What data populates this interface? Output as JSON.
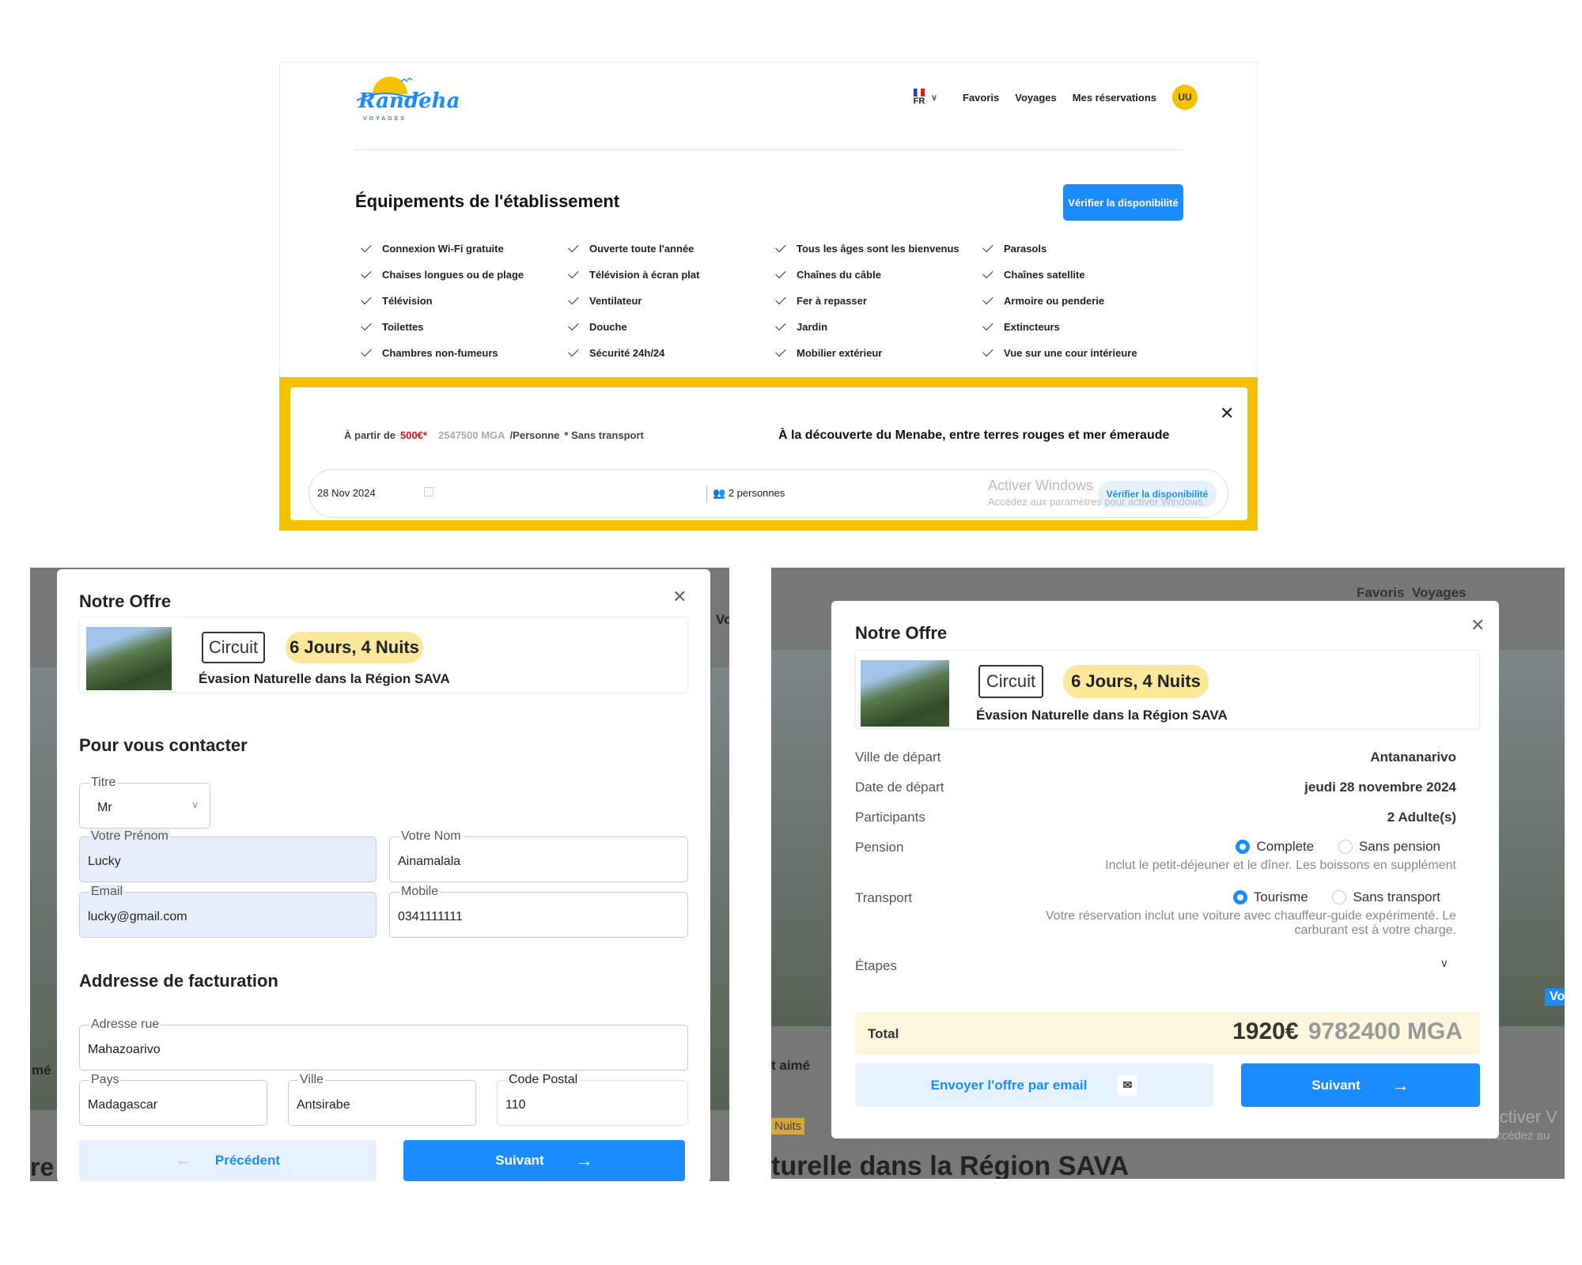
{
  "top": {
    "logo_text": "Randeha",
    "logo_sub": "VOYAGES",
    "lang": "FR",
    "nav": [
      "Favoris",
      "Voyages",
      "Mes réservations"
    ],
    "avatar": "UU",
    "section_title": "Équipements de l'établissement",
    "verify_label": "Vérifier la disponibilité",
    "amenities": [
      "Connexion Wi-Fi gratuite",
      "Ouverte toute l'année",
      "Tous les âges sont les bienvenus",
      "Parasols",
      "Chaises longues ou de plage",
      "Télévision à écran plat",
      "Chaînes du câble",
      "Chaînes satellite",
      "Télévision",
      "Ventilateur",
      "Fer à repasser",
      "Armoire ou penderie",
      "Toilettes",
      "Douche",
      "Jardin",
      "Extincteurs",
      "Chambres non-fumeurs",
      "Sécurité 24h/24",
      "Mobilier extérieur",
      "Vue sur une cour intérieure"
    ],
    "booking": {
      "from_label": "À partir de",
      "price_eur": "500€*",
      "price_mga": "2547500 MGA",
      "per_person": "/Personne",
      "transport": "* Sans transport",
      "tour_title": "À la découverte du Menabe, entre terres rouges et mer émeraude",
      "date": "28 Nov 2024",
      "persons": "2 personnes",
      "verify_label": "Vérifier la disponibilité",
      "watermark_title": "Activer Windows",
      "watermark_sub": "Accédez aux paramètres pour activer Windows."
    }
  },
  "left_modal": {
    "title": "Notre Offre",
    "tag": "Circuit",
    "duration": "6 Jours, 4 Nuits",
    "product": "Évasion Naturelle dans la Région SAVA",
    "contact_title": "Pour vous contacter",
    "fields": {
      "titre": {
        "label": "Titre",
        "value": "Mr"
      },
      "prenom": {
        "label": "Votre Prénom",
        "value": "Lucky"
      },
      "nom": {
        "label": "Votre Nom",
        "value": "Ainamalala"
      },
      "email": {
        "label": "Email",
        "value": "lucky@gmail.com"
      },
      "mobile": {
        "label": "Mobile",
        "value": "0341111111"
      },
      "adresse": {
        "label": "Adresse rue",
        "value": "Mahazoarivo"
      },
      "pays": {
        "label": "Pays",
        "value": "Madagascar"
      },
      "ville": {
        "label": "Ville",
        "value": "Antsirabe"
      },
      "postal": {
        "label": "Code Postal",
        "value": "110"
      }
    },
    "billing_title": "Addresse de facturation",
    "prev_label": "Précédent",
    "next_label": "Suivant",
    "bg_texts": [
      "Vo",
      "mé",
      "re"
    ]
  },
  "right_modal": {
    "title": "Notre Offre",
    "tag": "Circuit",
    "duration": "6 Jours, 4 Nuits",
    "product": "Évasion Naturelle dans la Région SAVA",
    "rows": {
      "ville_label": "Ville de départ",
      "ville_value": "Antananarivo",
      "date_label": "Date de départ",
      "date_value": "jeudi 28 novembre 2024",
      "participants_label": "Participants",
      "participants_value": "2 Adulte(s)",
      "pension_label": "Pension",
      "pension_opt1": "Complete",
      "pension_opt2": "Sans pension",
      "pension_note": "Inclut le petit-déjeuner et le dîner. Les boissons en supplément",
      "transport_label": "Transport",
      "transport_opt1": "Tourisme",
      "transport_opt2": "Sans transport",
      "transport_note": "Votre réservation inclut une voiture avec chauffeur-guide expérimenté. Le carburant est à votre charge.",
      "etapes_label": "Étapes"
    },
    "total_label": "Total",
    "total_eur": "1920€",
    "total_mga": "9782400 MGA",
    "email_label": "Envoyer l'offre par email",
    "next_label": "Suivant",
    "bg_texts": {
      "nav1": "Favoris",
      "nav2": "Voyages",
      "aime": "t aimé",
      "nuits": "Nuits",
      "heading": "turelle dans la Région SAVA",
      "vo": "Vo",
      "wm1": "Activer V",
      "wm2": "Accédez au"
    }
  }
}
